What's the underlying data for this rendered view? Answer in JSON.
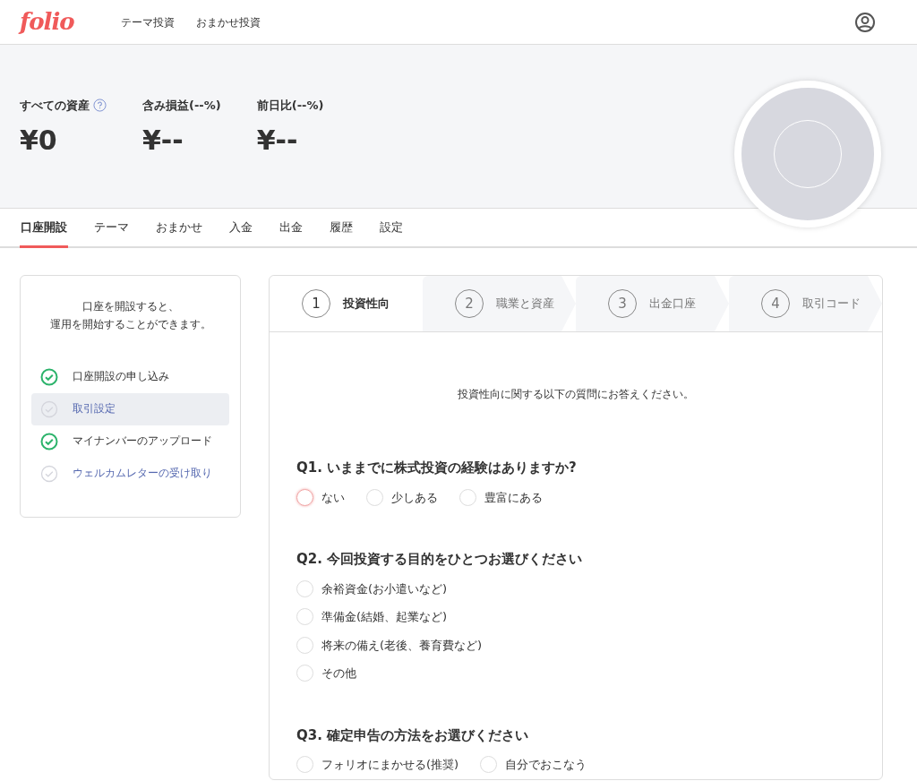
{
  "header": {
    "logo": "folio",
    "nav": [
      "テーマ投資",
      "おまかせ投資"
    ]
  },
  "summary": [
    {
      "label": "すべての資産",
      "help": true,
      "value": "¥0"
    },
    {
      "label": "含み損益(--%)",
      "help": false,
      "value": "¥--"
    },
    {
      "label": "前日比(--%)",
      "help": false,
      "value": "¥--"
    }
  ],
  "tabs": [
    {
      "label": "口座開設",
      "selected": true
    },
    {
      "label": "テーマ",
      "selected": false
    },
    {
      "label": "おまかせ",
      "selected": false
    },
    {
      "label": "入金",
      "selected": false
    },
    {
      "label": "出金",
      "selected": false
    },
    {
      "label": "履歴",
      "selected": false
    },
    {
      "label": "設定",
      "selected": false
    }
  ],
  "sidebar": {
    "message": [
      "口座を開設すると、",
      "運用を開始することができます。"
    ],
    "items": [
      {
        "label": "口座開設の申し込み",
        "done": true,
        "selected": false
      },
      {
        "label": "取引設定",
        "done": false,
        "selected": true
      },
      {
        "label": "マイナンバーのアップロード",
        "done": true,
        "selected": false
      },
      {
        "label": "ウェルカムレターの受け取り",
        "done": false,
        "selected": false
      }
    ]
  },
  "steps": [
    {
      "number": "1",
      "label": "投資性向",
      "selected": true
    },
    {
      "number": "2",
      "label": "職業と資産",
      "selected": false
    },
    {
      "number": "3",
      "label": "出金口座",
      "selected": false
    },
    {
      "number": "4",
      "label": "取引コード",
      "selected": false
    }
  ],
  "intro": "投資性向に関する以下の質問にお答えください。",
  "questions": [
    {
      "title": "Q1. いままでに株式投資の経験はありますか?",
      "kind": "inline",
      "options": [
        {
          "label": "ない",
          "selected": false,
          "focused": true
        },
        {
          "label": "少しある",
          "selected": false,
          "focused": false
        },
        {
          "label": "豊富にある",
          "selected": false,
          "focused": false
        }
      ]
    },
    {
      "title": "Q2. 今回投資する目的をひとつお選びください",
      "kind": "stacked",
      "options": [
        {
          "label": "余裕資金(お小遣いなど)",
          "selected": false,
          "focused": false
        },
        {
          "label": "準備金(結婚、起業など)",
          "selected": false,
          "focused": false
        },
        {
          "label": "将来の備え(老後、養育費など)",
          "selected": false,
          "focused": false
        },
        {
          "label": "その他",
          "selected": false,
          "focused": false
        }
      ]
    },
    {
      "title": "Q3. 確定申告の方法をお選びください",
      "kind": "inline",
      "options": [
        {
          "label": "フォリオにまかせる(推奨)",
          "selected": false,
          "focused": false
        },
        {
          "label": "自分でおこなう",
          "selected": false,
          "focused": false
        }
      ]
    }
  ]
}
